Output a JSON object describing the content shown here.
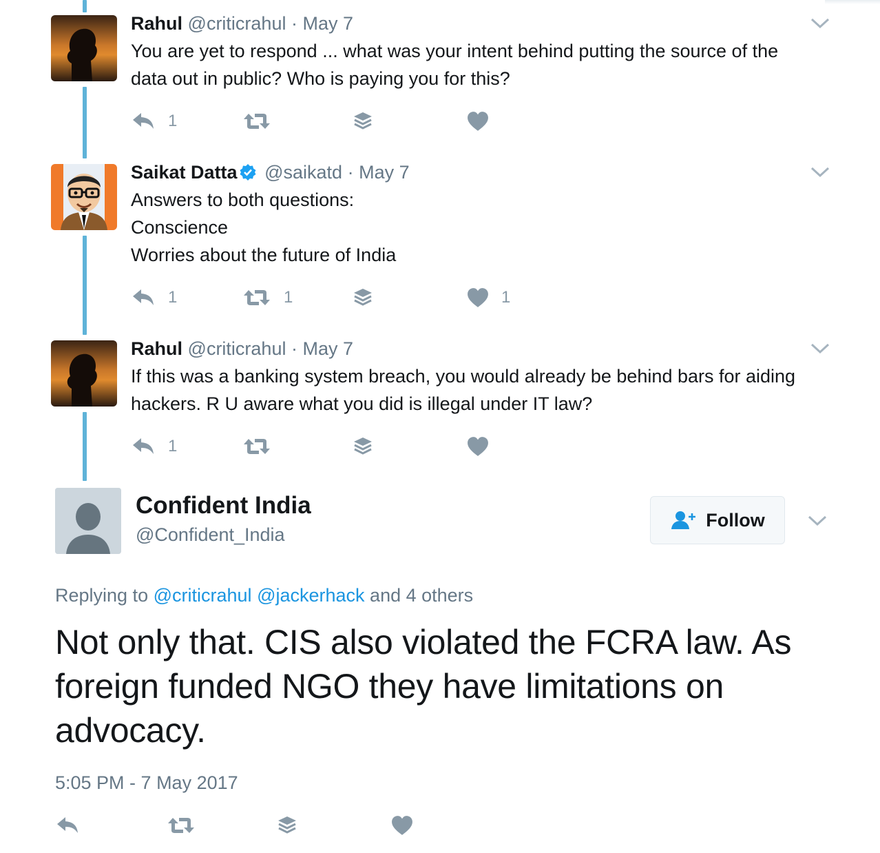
{
  "thread": [
    {
      "name": "Rahul",
      "handle": "@criticrahul",
      "sep": "·",
      "date": "May 7",
      "verified": false,
      "lines": [
        "You are yet to respond ... what was your intent behind putting the source of the",
        "data out in public? Who is paying you for this?"
      ],
      "reply_count": "1",
      "retweet_count": "",
      "like_count": ""
    },
    {
      "name": "Saikat Datta",
      "handle": "@saikatd",
      "sep": "·",
      "date": "May 7",
      "verified": true,
      "lines": [
        "Answers to both questions:",
        "Conscience",
        "Worries about the future of India"
      ],
      "reply_count": "1",
      "retweet_count": "1",
      "like_count": "1"
    },
    {
      "name": "Rahul",
      "handle": "@criticrahul",
      "sep": "·",
      "date": "May 7",
      "verified": false,
      "lines": [
        "If this was a banking system breach, you would already be behind bars for aiding",
        "hackers. R U aware what you did is illegal under IT law?"
      ],
      "reply_count": "1",
      "retweet_count": "",
      "like_count": ""
    }
  ],
  "main": {
    "name": "Confident India",
    "handle": "@Confident_India",
    "follow_label": "Follow",
    "replying_prefix": "Replying to",
    "replying_mention_1": "@criticrahul",
    "replying_mention_2": "@jackerhack",
    "replying_suffix": "and 4 others",
    "text": "Not only that. CIS also violated the FCRA law. As foreign funded NGO they have limitations on advocacy.",
    "timestamp": "5:05 PM - 7 May 2017"
  },
  "icons": {
    "reply": "reply-icon",
    "retweet": "retweet-icon",
    "buffer": "buffer-icon",
    "like": "heart-icon",
    "more": "chevron-down-icon",
    "verified": "verified-badge-icon",
    "follow": "add-user-icon"
  },
  "colors": {
    "accent": "#1b95e0",
    "thread_line": "#5fb3d8",
    "icon_gray": "#8899a6",
    "secondary_text": "#657786"
  }
}
